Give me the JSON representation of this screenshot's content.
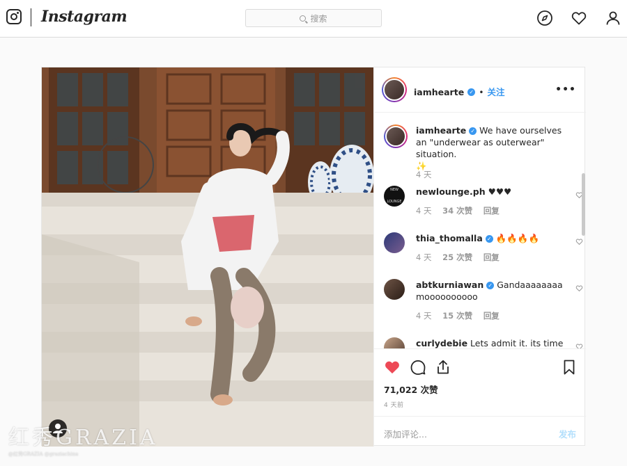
{
  "nav": {
    "brand": "Instagram",
    "search_placeholder": "搜索",
    "icons": [
      "instagram-logo-icon",
      "compass-icon",
      "heart-icon",
      "profile-icon"
    ]
  },
  "post": {
    "author": "iamhearte",
    "dot": "•",
    "follow_label": "关注",
    "more": "•••",
    "caption": {
      "username": "iamhearte",
      "text": "We have ourselves an \"underwear as outerwear\" situation.",
      "emoji": "✨",
      "time": "4 天"
    },
    "comments": [
      {
        "username": "newlounge.ph",
        "verified": false,
        "text": "♥♥♥",
        "time": "4 天",
        "likes": "34 次赞",
        "reply": "回复"
      },
      {
        "username": "thia_thomalla",
        "verified": true,
        "text": "🔥🔥🔥🔥",
        "time": "4 天",
        "likes": "25 次赞",
        "reply": "回复"
      },
      {
        "username": "abtkurniawan",
        "verified": true,
        "text": "Gandaaaaaaaa moooooooooo",
        "time": "4 天",
        "likes": "15 次赞",
        "reply": "回复"
      },
      {
        "username": "curlydebie",
        "verified": false,
        "text": "Lets admit it. its time",
        "time": "",
        "likes": "",
        "reply": ""
      }
    ],
    "likes_count": "71,022 次赞",
    "time_ago": "4 天前",
    "add_comment_placeholder": "添加评论...",
    "post_button": "发布",
    "avatar_label": "NEW LOUNGE"
  },
  "watermark": {
    "cn": "红秀",
    "en": "GRAZIA",
    "handles": "@红秀GRAZIA  @graziachina"
  },
  "colors": {
    "accent": "#3897f0",
    "like_red": "#ed4956",
    "border": "#dbdbdb",
    "muted": "#999999"
  }
}
